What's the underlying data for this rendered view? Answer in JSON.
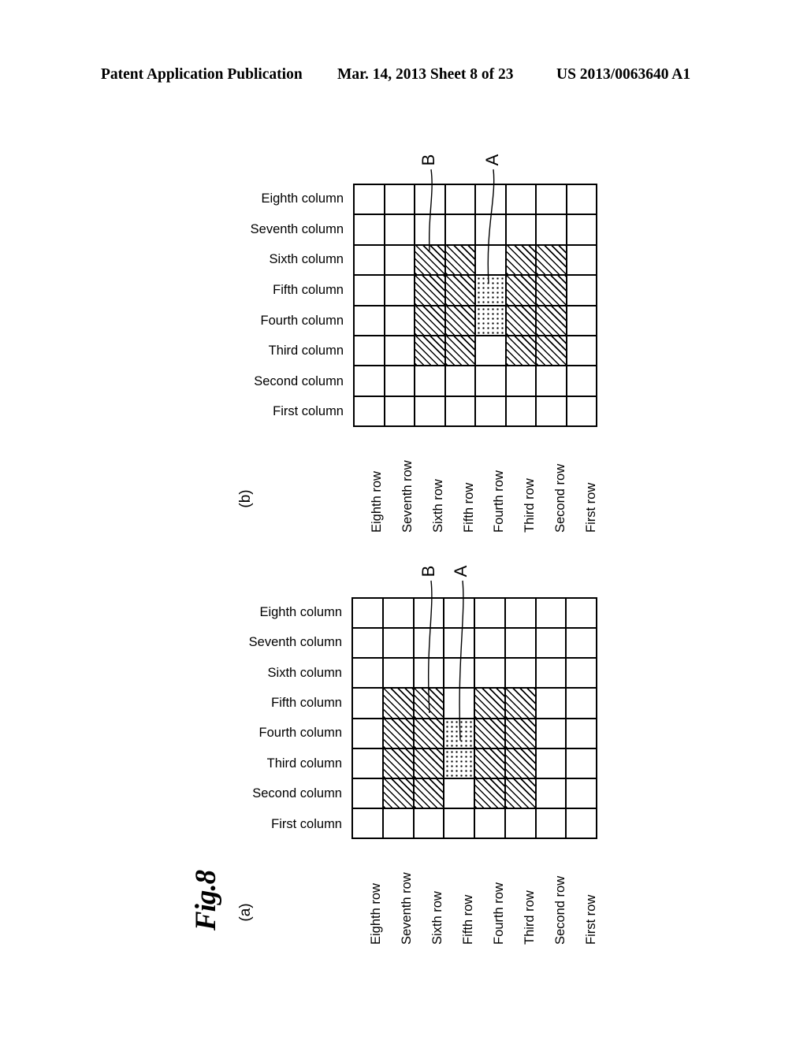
{
  "header": {
    "left": "Patent Application Publication",
    "middle": "Mar. 14, 2013  Sheet 8 of 23",
    "right": "US 2013/0063640 A1"
  },
  "figure": {
    "title": "Fig.8",
    "panels": [
      {
        "tag": "(b)",
        "column_labels": [
          "Eighth column",
          "Seventh column",
          "Sixth column",
          "Fifth column",
          "Fourth column",
          "Third column",
          "Second column",
          "First column"
        ],
        "row_labels": [
          "Eighth row",
          "Seventh row",
          "Sixth row",
          "Fifth row",
          "Fourth row",
          "Third row",
          "Second row",
          "First row"
        ],
        "callouts": [
          {
            "letter": "B",
            "target": "hatched-cell"
          },
          {
            "letter": "A",
            "target": "dotted-cell"
          }
        ],
        "grid": {
          "rows": 8,
          "cols": 8,
          "cells": [
            [
              "",
              "",
              "",
              "",
              "",
              "",
              "",
              ""
            ],
            [
              "",
              "",
              "",
              "",
              "",
              "",
              "",
              ""
            ],
            [
              "",
              "",
              "hatch",
              "hatch",
              "",
              "hatch",
              "hatch",
              ""
            ],
            [
              "",
              "",
              "hatch",
              "hatch",
              "dots",
              "hatch",
              "hatch",
              ""
            ],
            [
              "",
              "",
              "hatch",
              "hatch",
              "dots",
              "hatch",
              "hatch",
              ""
            ],
            [
              "",
              "",
              "hatch",
              "hatch",
              "",
              "hatch",
              "hatch",
              ""
            ],
            [
              "",
              "",
              "",
              "",
              "",
              "",
              "",
              ""
            ],
            [
              "",
              "",
              "",
              "",
              "",
              "",
              "",
              ""
            ]
          ]
        }
      },
      {
        "tag": "(a)",
        "column_labels": [
          "Eighth column",
          "Seventh column",
          "Sixth column",
          "Fifth column",
          "Fourth column",
          "Third column",
          "Second column",
          "First column"
        ],
        "row_labels": [
          "Eighth row",
          "Seventh row",
          "Sixth row",
          "Fifth row",
          "Fourth row",
          "Third row",
          "Second row",
          "First row"
        ],
        "callouts": [
          {
            "letter": "B",
            "target": "hatched-cell"
          },
          {
            "letter": "A",
            "target": "dotted-cell"
          }
        ],
        "grid": {
          "rows": 8,
          "cols": 8,
          "cells": [
            [
              "",
              "",
              "",
              "",
              "",
              "",
              "",
              ""
            ],
            [
              "",
              "",
              "",
              "",
              "",
              "",
              "",
              ""
            ],
            [
              "",
              "",
              "",
              "",
              "",
              "",
              "",
              ""
            ],
            [
              "",
              "hatch",
              "hatch",
              "",
              "hatch",
              "hatch",
              "",
              ""
            ],
            [
              "",
              "hatch",
              "hatch",
              "dots",
              "hatch",
              "hatch",
              "",
              ""
            ],
            [
              "",
              "hatch",
              "hatch",
              "dots",
              "hatch",
              "hatch",
              "",
              ""
            ],
            [
              "",
              "hatch",
              "hatch",
              "",
              "hatch",
              "hatch",
              "",
              ""
            ],
            [
              "",
              "",
              "",
              "",
              "",
              "",
              "",
              ""
            ]
          ]
        }
      }
    ]
  },
  "colors": {
    "ink": "#000000",
    "paper": "#ffffff"
  }
}
